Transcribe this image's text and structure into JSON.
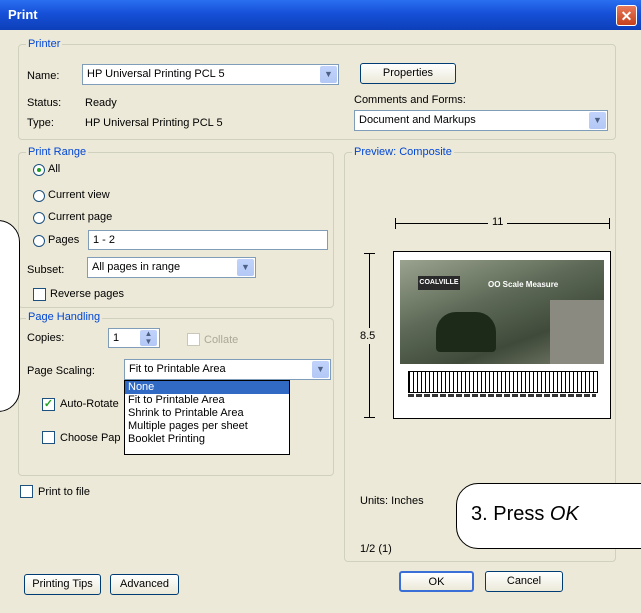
{
  "window": {
    "title": "Print",
    "close_glyph": "✕"
  },
  "printer": {
    "legend": "Printer",
    "name_label": "Name:",
    "name_value": "HP Universal Printing PCL 5",
    "status_label": "Status:",
    "status_value": "Ready",
    "type_label": "Type:",
    "type_value": "HP Universal Printing PCL 5",
    "properties_button": "Properties",
    "comments_label": "Comments and Forms:",
    "comments_value": "Document and Markups"
  },
  "print_range": {
    "legend": "Print Range",
    "all": "All",
    "current_view": "Current view",
    "current_page": "Current page",
    "pages": "Pages",
    "pages_value": "1 - 2",
    "selected": "All",
    "subset_label": "Subset:",
    "subset_value": "All pages in range",
    "reverse_pages": "Reverse pages"
  },
  "page_handling": {
    "legend": "Page Handling",
    "copies_label": "Copies:",
    "copies_value": "1",
    "collate": "Collate",
    "scaling_label": "Page Scaling:",
    "scaling_value": "Fit to Printable Area",
    "scaling_options": [
      "None",
      "Fit to Printable Area",
      "Shrink to Printable Area",
      "Multiple pages per sheet",
      "Booklet Printing"
    ],
    "scaling_highlighted": "None",
    "auto_rotate": "Auto-Rotate",
    "auto_rotate_checked": true,
    "choose_paper": "Choose Pap",
    "choose_paper_checked": false
  },
  "print_to_file": "Print to file",
  "preview": {
    "legend": "Preview: Composite",
    "width_label": "11",
    "height_label": "8.5",
    "brand_text": "COALVILLE",
    "caption": "OO Scale Measure",
    "units": "Units: Inches",
    "page_indicator": "1/2 (1)"
  },
  "callout": {
    "text_prefix": "3. Press ",
    "text_emph": "OK"
  },
  "buttons": {
    "printing_tips": "Printing Tips",
    "advanced": "Advanced",
    "ok": "OK",
    "cancel": "Cancel"
  },
  "icons": {
    "dropdown": "chevron-down-icon",
    "spin": "spin-arrows-icon",
    "close": "close-icon"
  }
}
